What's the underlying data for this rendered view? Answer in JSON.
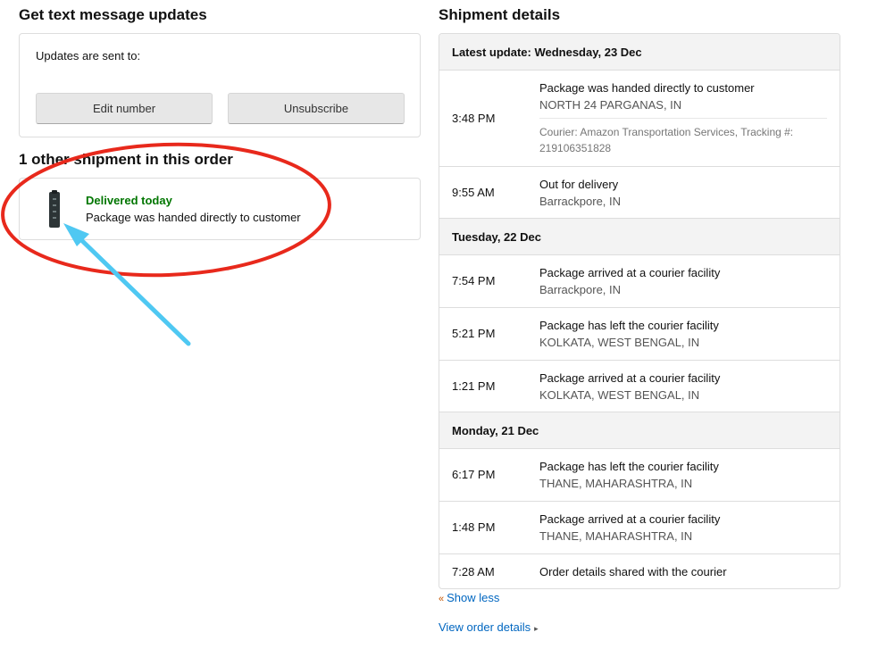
{
  "sms": {
    "heading": "Get text message updates",
    "sent_to_label": "Updates are sent to:",
    "edit_button": "Edit number",
    "unsubscribe_button": "Unsubscribe"
  },
  "other_shipment": {
    "heading": "1 other shipment in this order",
    "status": "Delivered today",
    "description": "Package was handed directly to customer",
    "thumbnail_icon": "product-thumbnail-icon"
  },
  "annotation": {
    "ellipse_color": "#e8291c",
    "arrow_color": "#4fc8f2"
  },
  "shipment": {
    "heading": "Shipment details",
    "days": [
      {
        "label": "Latest update: Wednesday, 23 Dec",
        "events": [
          {
            "time": "3:48 PM",
            "title": "Package was handed directly to customer",
            "location": "NORTH 24 PARGANAS, IN",
            "courier": "Courier: Amazon Transportation Services, Tracking #: 219106351828"
          },
          {
            "time": "9:55 AM",
            "title": "Out for delivery",
            "location": "Barrackpore, IN"
          }
        ]
      },
      {
        "label": "Tuesday, 22 Dec",
        "events": [
          {
            "time": "7:54 PM",
            "title": "Package arrived at a courier facility",
            "location": "Barrackpore, IN"
          },
          {
            "time": "5:21 PM",
            "title": "Package has left the courier facility",
            "location": "KOLKATA, WEST BENGAL, IN"
          },
          {
            "time": "1:21 PM",
            "title": "Package arrived at a courier facility",
            "location": "KOLKATA, WEST BENGAL, IN"
          }
        ]
      },
      {
        "label": "Monday, 21 Dec",
        "events": [
          {
            "time": "6:17 PM",
            "title": "Package has left the courier facility",
            "location": "THANE, MAHARASHTRA, IN"
          },
          {
            "time": "1:48 PM",
            "title": "Package arrived at a courier facility",
            "location": "THANE, MAHARASHTRA, IN"
          },
          {
            "time": "7:28 AM",
            "title": "Order details shared with the courier"
          }
        ]
      }
    ],
    "show_less": "Show less",
    "view_order": "View order details"
  }
}
